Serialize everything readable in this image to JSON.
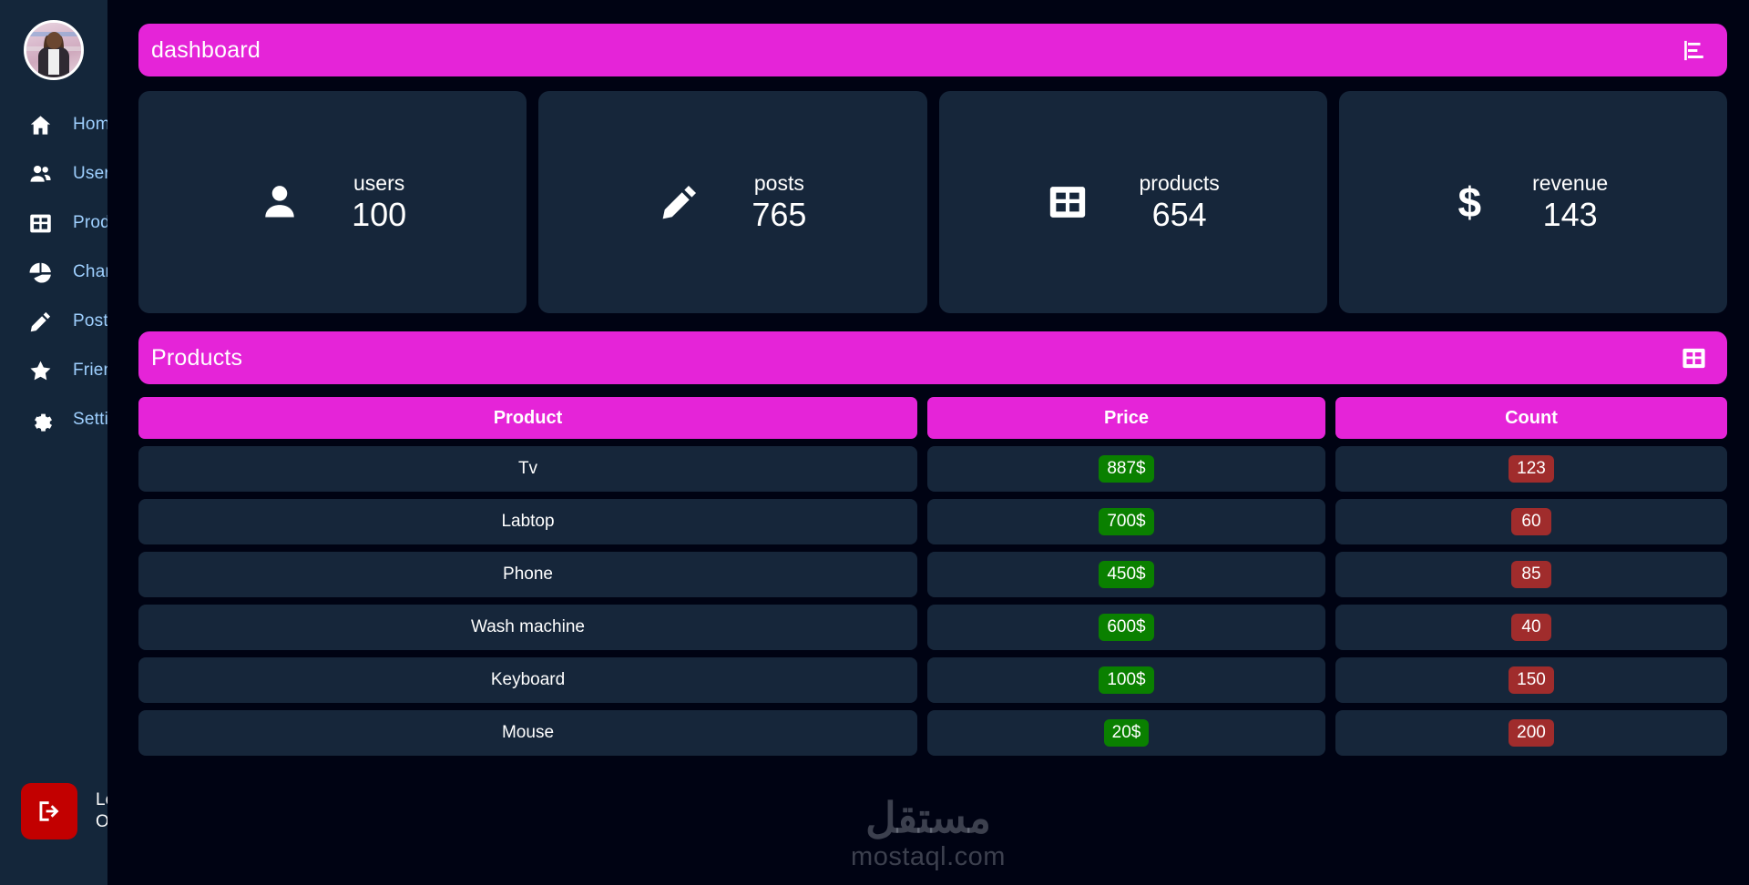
{
  "sidebar": {
    "avatar_alt": "user-profile-photo",
    "items": [
      {
        "icon": "home-icon",
        "label": "Home"
      },
      {
        "icon": "users-icon",
        "label": "Users"
      },
      {
        "icon": "table-icon",
        "label": "Products"
      },
      {
        "icon": "pie-chart-icon",
        "label": "Charts"
      },
      {
        "icon": "pencil-icon",
        "label": "Posts"
      },
      {
        "icon": "star-icon",
        "label": "Friends"
      },
      {
        "icon": "gear-icon",
        "label": "Settings"
      }
    ],
    "logout": {
      "icon": "logout-icon",
      "line1": "Log",
      "line2": "Out"
    }
  },
  "header": {
    "title": "dashboard",
    "icon": "bar-chart-icon"
  },
  "stats": [
    {
      "icon": "person-icon",
      "label": "users",
      "value": "100"
    },
    {
      "icon": "pencil-icon",
      "label": "posts",
      "value": "765"
    },
    {
      "icon": "table-icon",
      "label": "products",
      "value": "654"
    },
    {
      "icon": "dollar-icon",
      "label": "revenue",
      "value": "143"
    }
  ],
  "products_section": {
    "title": "Products",
    "icon": "table-icon"
  },
  "table": {
    "columns": [
      "Product",
      "Price",
      "Count"
    ],
    "rows": [
      {
        "product": "Tv",
        "price": "887$",
        "count": "123"
      },
      {
        "product": "Labtop",
        "price": "700$",
        "count": "60"
      },
      {
        "product": "Phone",
        "price": "450$",
        "count": "85"
      },
      {
        "product": "Wash machine",
        "price": "600$",
        "count": "40"
      },
      {
        "product": "Keyboard",
        "price": "100$",
        "count": "150"
      },
      {
        "product": "Mouse",
        "price": "20$",
        "count": "200"
      }
    ]
  },
  "watermark": {
    "arabic": "مستقل",
    "latin": "mostaql.com"
  },
  "colors": {
    "accent": "#e524d8",
    "sidebar": "#14263a",
    "card": "#16263a",
    "background": "#000313",
    "price_badge": "#0a8000",
    "count_badge": "#a02c2c",
    "logout": "#c20000",
    "nav_label": "#9fd0ff"
  }
}
